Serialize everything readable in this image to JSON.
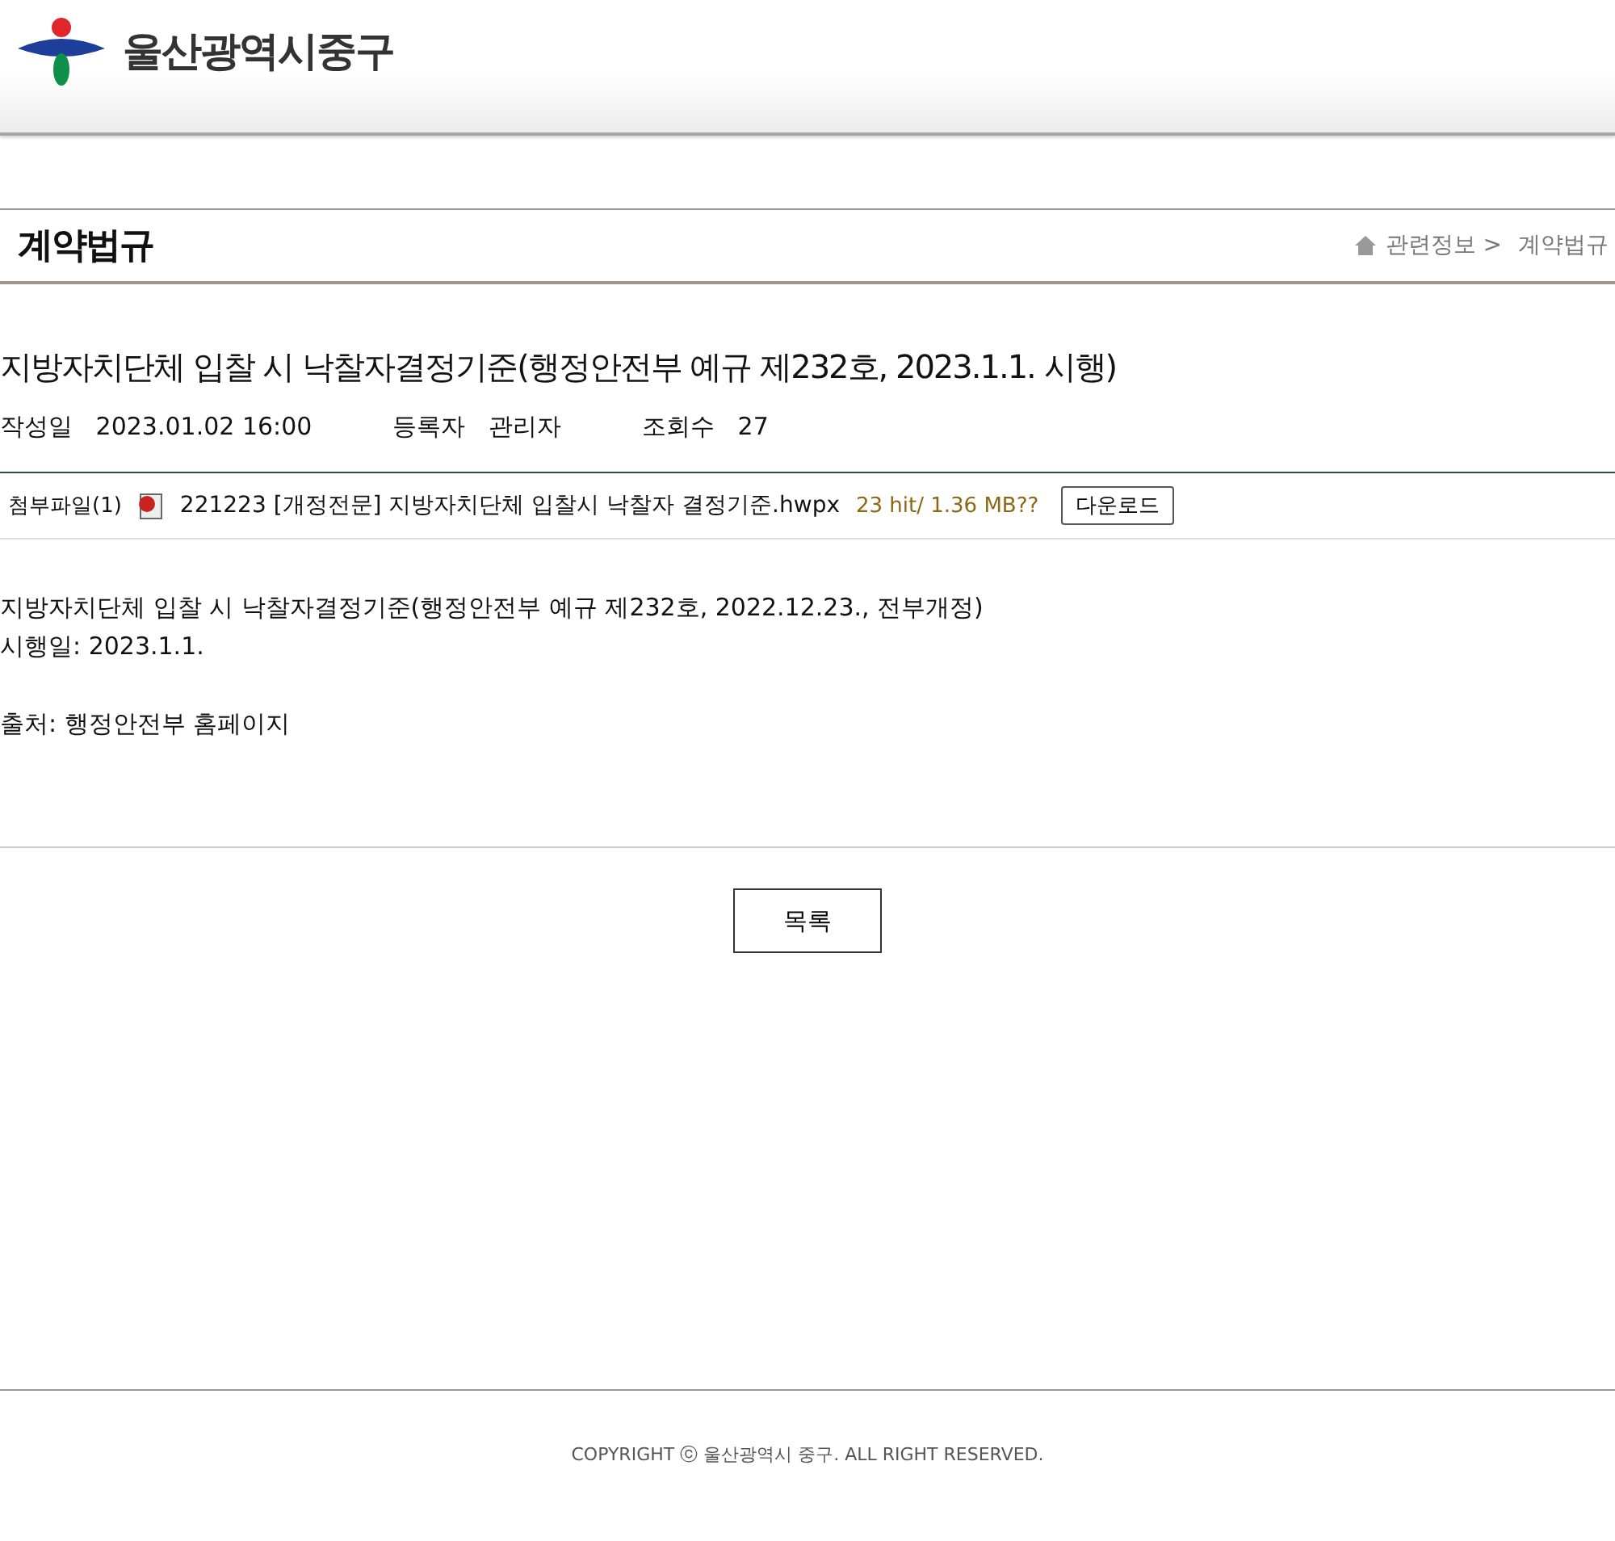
{
  "header": {
    "site_name": "울산광역시중구"
  },
  "page": {
    "title": "계약법규",
    "breadcrumb": [
      "관련정보 >",
      "계약법규"
    ]
  },
  "post": {
    "title": "지방자치단체 입찰 시 낙찰자결정기준(행정안전부 예규 제232호, 2023.1.1. 시행)",
    "meta": [
      {
        "label": "작성일",
        "value": "2023.01.02 16:00"
      },
      {
        "label": "등록자",
        "value": "관리자"
      },
      {
        "label": "조회수",
        "value": "27"
      }
    ],
    "attachment": {
      "label": "첨부파일(1)",
      "file_name": "221223 [개정전문] 지방자치단체 입찰시 낙찰자 결정기준.hwpx",
      "info": "23 hit/ 1.36 MB??",
      "button": "다운로드"
    },
    "paragraphs": [
      [
        "지방자치단체 입찰 시 낙찰자결정기준(행정안전부 예규 제232호, 2022.12.23., 전부개정)",
        "시행일: 2023.1.1."
      ],
      [
        "출처: 행정안전부 홈페이지"
      ]
    ]
  },
  "list_button": "목록",
  "footer": {
    "copyright": "COPYRIGHT ⓒ 울산광역시 중구. ALL RIGHT RESERVED."
  }
}
